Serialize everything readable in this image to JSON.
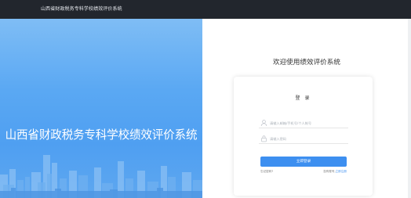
{
  "header": {
    "title": "山西省财政税务专科学校绩效评价系统"
  },
  "banner": {
    "title": "山西省财政税务专科学校绩效评价系统"
  },
  "login": {
    "welcome": "欢迎使用绩效评价系统",
    "title": "登 录",
    "username_placeholder": "请输入邮箱/手机号/个人帐号",
    "password_placeholder": "请输入密码",
    "submit_label": "立即登录",
    "forgot_label": "忘记密码?",
    "no_account_label": "没有账号,",
    "register_label": "立即注册"
  },
  "colors": {
    "topbar": "#22262d",
    "banner": "#5aa8f3",
    "accent": "#3d8ff0"
  },
  "icons": {
    "user": "user-icon",
    "lock": "lock-icon"
  }
}
